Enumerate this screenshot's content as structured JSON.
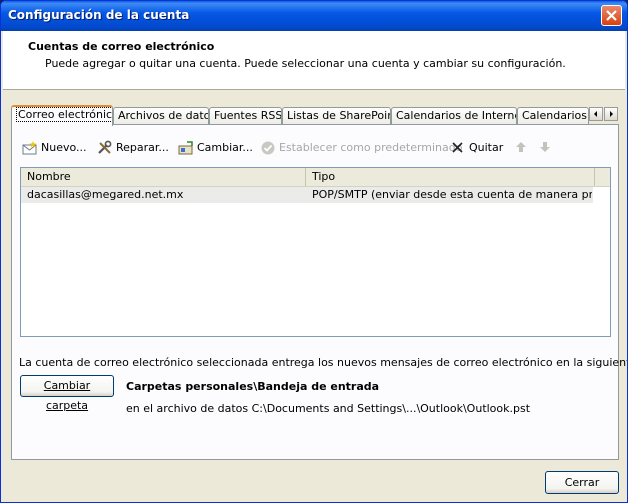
{
  "window": {
    "title": "Configuración de la cuenta"
  },
  "header": {
    "title": "Cuentas de correo electrónico",
    "subtitle": "Puede agregar o quitar una cuenta. Puede seleccionar una cuenta y cambiar su configuración."
  },
  "tabs": [
    {
      "label": "Correo electrónico",
      "active": true
    },
    {
      "label": "Archivos de datos"
    },
    {
      "label": "Fuentes RSS"
    },
    {
      "label": "Listas de SharePoint"
    },
    {
      "label": "Calendarios de Internet"
    },
    {
      "label": "Calendarios p"
    }
  ],
  "toolbar": {
    "new_label": "Nuevo...",
    "repair_label": "Reparar...",
    "change_label": "Cambiar...",
    "default_label": "Establecer como predeterminado",
    "remove_label": "Quitar"
  },
  "table": {
    "columns": [
      "Nombre",
      "Tipo"
    ],
    "rows": [
      {
        "name": "dacasillas@megared.net.mx",
        "type": "POP/SMTP (enviar desde esta cuenta de manera pred..."
      }
    ]
  },
  "delivery": {
    "info": "La cuenta de correo electrónico seleccionada entrega los nuevos mensajes de correo electrónico en la siguiente ubicación:",
    "change_folder_label": "Cambiar carpeta",
    "folder": "Carpetas personales\\Bandeja de entrada",
    "data_file": "en el archivo de datos C:\\Documents and Settings\\...\\Outlook\\Outlook.pst"
  },
  "footer": {
    "close_label": "Cerrar"
  },
  "colors": {
    "titlebar": "#0558e6",
    "dialog_bg": "#ece9d8",
    "tab_highlight": "#e68b2c"
  }
}
